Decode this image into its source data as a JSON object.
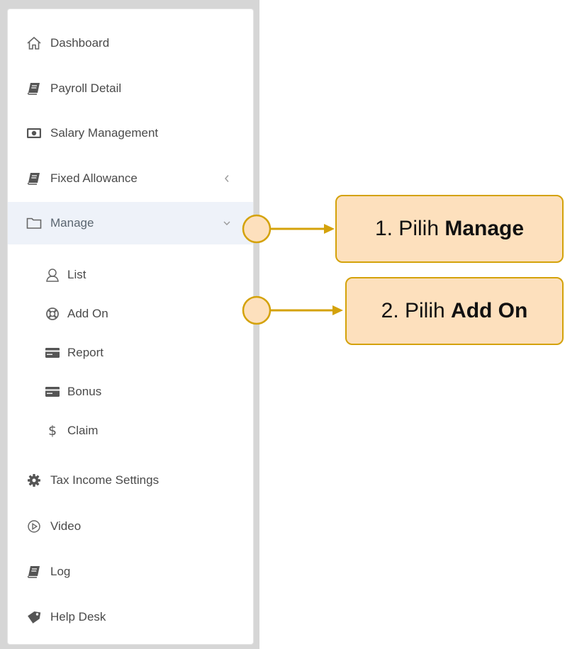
{
  "sidebar": {
    "items": [
      {
        "label": "Dashboard",
        "icon": "home-icon"
      },
      {
        "label": "Payroll Detail",
        "icon": "book-icon"
      },
      {
        "label": "Salary Management",
        "icon": "money-icon"
      },
      {
        "label": "Fixed Allowance",
        "icon": "book-icon",
        "caret": "<"
      },
      {
        "label": "Manage",
        "icon": "folder-icon",
        "active": true,
        "caret": "v"
      },
      {
        "label": "List",
        "icon": "user-icon",
        "sub": true
      },
      {
        "label": "Add On",
        "icon": "lifebuoy-icon",
        "sub": true
      },
      {
        "label": "Report",
        "icon": "card-icon",
        "sub": true
      },
      {
        "label": "Bonus",
        "icon": "card-icon",
        "sub": true
      },
      {
        "label": "Claim",
        "icon": "dollar-icon",
        "sub": true,
        "glyph": "$"
      },
      {
        "label": "Tax Income Settings",
        "icon": "gear-icon"
      },
      {
        "label": "Video",
        "icon": "play-circle-icon"
      },
      {
        "label": "Log",
        "icon": "book-icon"
      },
      {
        "label": "Help Desk",
        "icon": "tag-icon"
      }
    ]
  },
  "callouts": [
    {
      "prefix": "1. Pilih ",
      "bold": "Manage"
    },
    {
      "prefix": "2. Pilih ",
      "bold": "Add On"
    }
  ],
  "colors": {
    "accent_border": "#d4a20a",
    "callout_fill": "#fde0bd",
    "active_row": "#eef2f9",
    "icon": "#555555"
  }
}
